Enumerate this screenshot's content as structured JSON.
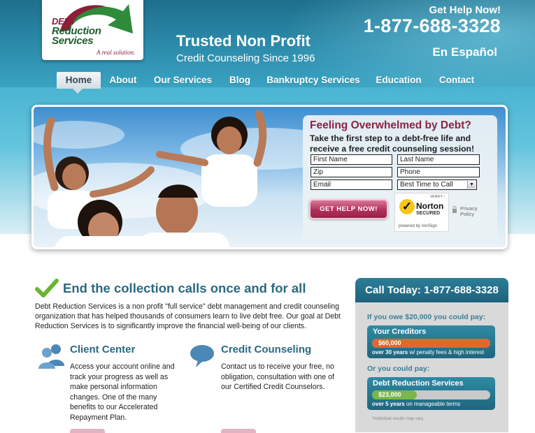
{
  "header": {
    "logo": {
      "line1": "DEBT",
      "line2": "Reduction",
      "line3": "Services",
      "tagline": "A real solution."
    },
    "tagline_main": "Trusted Non Profit",
    "tagline_sub": "Credit Counseling Since 1996",
    "get_help": "Get Help Now!",
    "phone": "1-877-688-3328",
    "spanish_link": "En Español"
  },
  "nav": {
    "items": [
      {
        "label": "Home"
      },
      {
        "label": "About"
      },
      {
        "label": "Our Services"
      },
      {
        "label": "Blog"
      },
      {
        "label": "Bankruptcy Services"
      },
      {
        "label": "Education"
      },
      {
        "label": "Contact"
      }
    ],
    "active": "Home"
  },
  "hero_form": {
    "title": "Feeling Overwhelmed by Debt?",
    "subtitle": "Take the first step to a debt-free life and receive a free credit counseling session!",
    "fields": {
      "first_name": "First Name",
      "last_name": "Last Name",
      "zip": "Zip",
      "phone": "Phone",
      "email": "Email",
      "best_time": "Best Time to Call"
    },
    "submit": "GET HELP NOW!",
    "norton": {
      "verify": "VERIFY ›",
      "brand": "Norton",
      "secured": "SECURED",
      "powered": "powered by VeriSign"
    },
    "privacy": {
      "line1": "Privacy",
      "line2": "Policy"
    }
  },
  "main": {
    "heading": "End the collection calls once and for all",
    "intro": "Debt Reduction Services is a non profit \"full service\" debt management and credit counseling organization that has helped thousands of consumers learn to live debt free. Our goal at Debt Reduction Services is to significantly improve the financial well-being of our clients.",
    "columns": [
      {
        "title": "Client Center",
        "icon": "users-icon",
        "text": "Access your account online and track your progress as well as make personal information changes. One of the many benefits to our Accelerated Repayment Plan."
      },
      {
        "title": "Credit Counseling",
        "icon": "speech-bubble-icon",
        "text": "Contact us to receive your free, no obligation, consultation with one of our Certified Credit Counselors."
      }
    ]
  },
  "sidebar": {
    "heading": "Call Today: 1-877-688-3328",
    "question1": "If you owe $20,000 you could pay:",
    "creditors": {
      "title": "Your Creditors",
      "amount": "$60,000",
      "fill": 1.0,
      "note_bold": "over 30 years",
      "note_rest": " w/ penalty fees & high interest",
      "color": "#e2672d"
    },
    "question2": "Or you could pay:",
    "drs": {
      "title": "Debt Reduction Services",
      "amount": "$23,000",
      "fill": 0.38,
      "note_bold": "over 5 years",
      "note_rest": " on manageable terms",
      "color": "#7ab648"
    },
    "fine_print": "*Individual results may vary."
  },
  "colors": {
    "header_blue": "#2a87a7",
    "heading_teal": "#2a6a82",
    "brand_maroon": "#8b2340",
    "button_pink": "#b1305b"
  }
}
